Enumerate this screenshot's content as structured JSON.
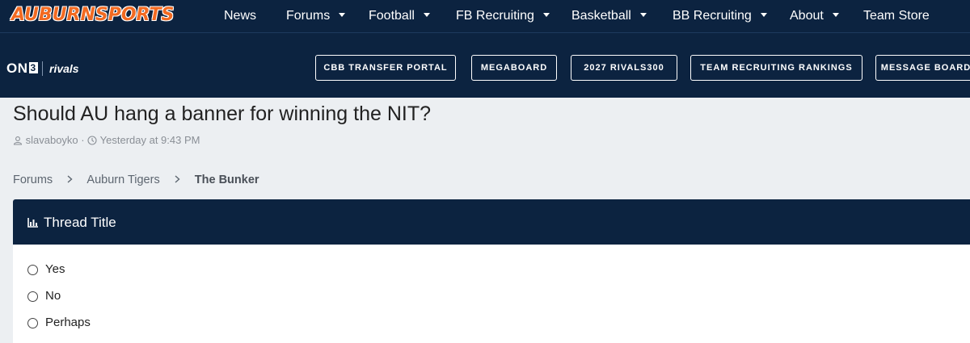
{
  "site": {
    "logo_text": "AUBURNSPORTS"
  },
  "nav": {
    "items": [
      {
        "label": "News",
        "dropdown": false
      },
      {
        "label": "Forums",
        "dropdown": true
      },
      {
        "label": "Football",
        "dropdown": true
      },
      {
        "label": "FB Recruiting",
        "dropdown": true
      },
      {
        "label": "Basketball",
        "dropdown": true
      },
      {
        "label": "BB Recruiting",
        "dropdown": true
      },
      {
        "label": "About",
        "dropdown": true
      },
      {
        "label": "Team Store",
        "dropdown": false
      }
    ]
  },
  "subbar": {
    "on3_text": "ON",
    "on3_num": "3",
    "rivals_text": "rivals",
    "buttons": [
      "CBB TRANSFER PORTAL",
      "MEGABOARD",
      "2027 RIVALS300",
      "TEAM RECRUITING RANKINGS",
      "MESSAGE BOARD"
    ]
  },
  "thread": {
    "title": "Should AU hang a banner for winning the NIT?",
    "author": "slavaboyko",
    "separator": "·",
    "time": "Yesterday at 9:43 PM"
  },
  "breadcrumb": {
    "items": [
      "Forums",
      "Auburn Tigers",
      "The Bunker"
    ]
  },
  "poll": {
    "title": "Thread Title",
    "options": [
      "Yes",
      "No",
      "Perhaps"
    ]
  },
  "colors": {
    "navy": "#0c2340",
    "orange": "#f26a21",
    "page_bg": "#eceff2"
  },
  "icons": [
    "user-icon",
    "clock-icon",
    "chevron-right-icon",
    "bar-chart-icon",
    "chevron-down-icon"
  ]
}
